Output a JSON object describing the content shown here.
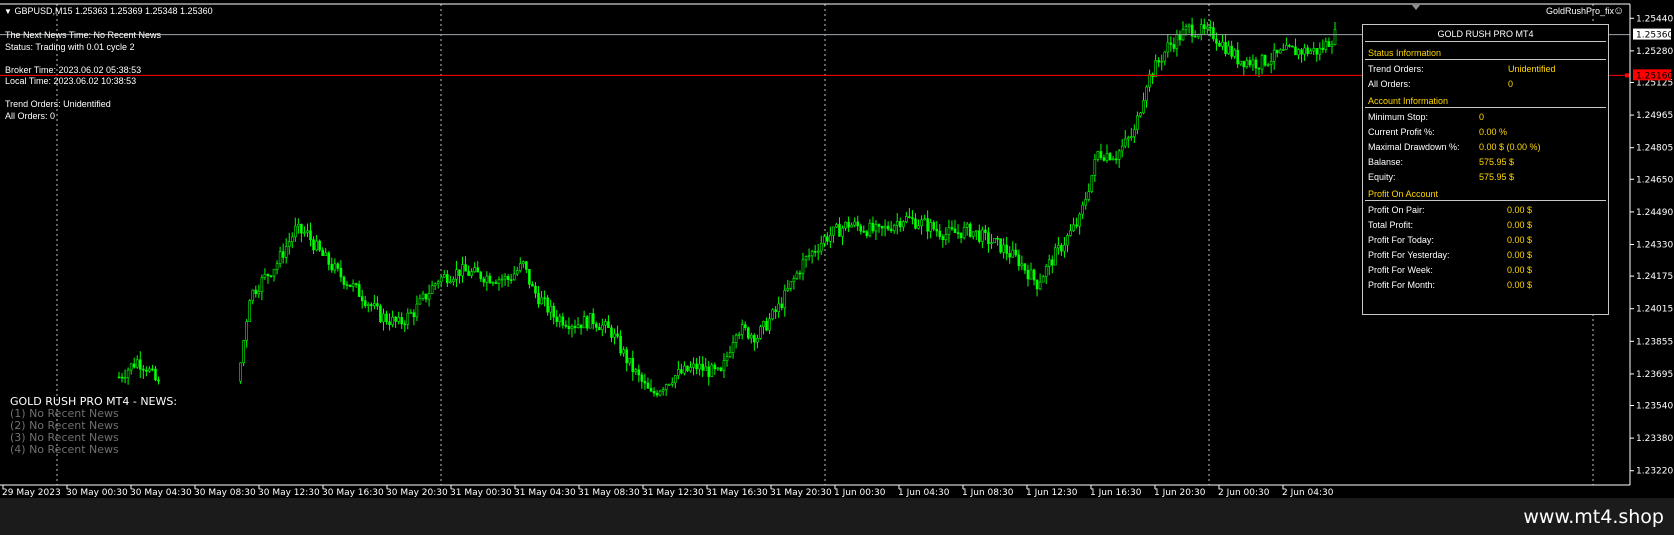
{
  "symbol_header": {
    "label": "GBPUSD,M15  1.25363 1.25369 1.25348 1.25360"
  },
  "ea": {
    "name": "GoldRushPro_fix",
    "face_icon": "smiley-icon"
  },
  "info_lines": {
    "news_time": "The Next News Time: No Recent News",
    "status": "Status: Trading with 0.01 cycle 2",
    "broker_time": "Broker Time: 2023.06.02 05:38:53",
    "local_time": "Local Time: 2023.06.02 10:38:53",
    "trend_orders": "Trend Orders: Unidentified",
    "all_orders": "All Orders: 0"
  },
  "news": {
    "title": "GOLD RUSH PRO MT4 - NEWS:",
    "items": [
      "(1)  No Recent News",
      "(2)  No Recent News",
      "(3)  No Recent News",
      "(4)  No Recent News"
    ]
  },
  "panel": {
    "title": "GOLD RUSH PRO MT4",
    "status_section": "Status Information",
    "status": [
      {
        "k": "Trend Orders:",
        "v": "Unidentified"
      },
      {
        "k": "All Orders:",
        "v": "0"
      }
    ],
    "account_section": "Account Information",
    "account": [
      {
        "k": "Minimum Stop:",
        "v": "0"
      },
      {
        "k": "Current Profit %:",
        "v": "0.00 %"
      },
      {
        "k": "Maximal Drawdown %:",
        "v": "0.00 $ (0.00 %)"
      },
      {
        "k": "Balanse:",
        "v": "575.95 $"
      },
      {
        "k": "Equity:",
        "v": "575.95 $"
      }
    ],
    "profit_section": "Profit On Account",
    "profit": [
      {
        "k": "Profit On Pair:",
        "v": "0.00 $"
      },
      {
        "k": "Total Profit:",
        "v": "0.00 $"
      },
      {
        "k": "Profit For Today:",
        "v": "0.00 $"
      },
      {
        "k": "Profit For Yesterday:",
        "v": "0.00 $"
      },
      {
        "k": "Profit For Week:",
        "v": "0.00 $"
      },
      {
        "k": "Profit For Month:",
        "v": "0.00 $"
      }
    ]
  },
  "price_axis": {
    "ticks": [
      "1.25440",
      "1.25280",
      "1.25125",
      "1.24965",
      "1.24805",
      "1.24650",
      "1.24490",
      "1.24330",
      "1.24175",
      "1.24015",
      "1.23855",
      "1.23695",
      "1.23540",
      "1.23380",
      "1.23220"
    ],
    "tick_values": [
      1.2544,
      1.2528,
      1.25125,
      1.24965,
      1.24805,
      1.2465,
      1.2449,
      1.2433,
      1.24175,
      1.24015,
      1.23855,
      1.23695,
      1.2354,
      1.2338,
      1.2322
    ],
    "bid_label": "1.25360",
    "bid_value": 1.2536,
    "red_label": "1.25160",
    "red_value": 1.2516
  },
  "time_axis": {
    "labels": [
      "29 May 2023",
      "30 May 00:30",
      "30 May 04:30",
      "30 May 08:30",
      "30 May 12:30",
      "30 May 16:30",
      "30 May 20:30",
      "31 May 00:30",
      "31 May 04:30",
      "31 May 08:30",
      "31 May 12:30",
      "31 May 16:30",
      "31 May 20:30",
      "1 Jun 00:30",
      "1 Jun 04:30",
      "1 Jun 08:30",
      "1 Jun 12:30",
      "1 Jun 16:30",
      "1 Jun 20:30",
      "2 Jun 00:30",
      "2 Jun 04:30"
    ]
  },
  "chart_data": {
    "type": "candlestick",
    "symbol": "GBPUSD",
    "timeframe": "M15",
    "ylim": [
      1.2315,
      1.2551
    ],
    "colors": {
      "bull": "#00ff00",
      "bear": "#00ff00",
      "grid": "#c0c0c0",
      "bid_line": "#9fa8b0",
      "red_line": "#ff0000"
    },
    "close_path": [
      [
        0,
        1.2368
      ],
      [
        6,
        1.2376
      ],
      [
        9,
        1.2373
      ],
      [
        13,
        1.2364
      ],
      [
        20,
        1.2356
      ],
      [
        32,
        1.2358
      ],
      [
        40,
        1.2375
      ],
      [
        43,
        1.2408
      ],
      [
        52,
        1.2424
      ],
      [
        58,
        1.244
      ],
      [
        62,
        1.2438
      ],
      [
        66,
        1.2429
      ],
      [
        72,
        1.2419
      ],
      [
        80,
        1.2408
      ],
      [
        86,
        1.2398
      ],
      [
        92,
        1.2394
      ],
      [
        97,
        1.24
      ],
      [
        105,
        1.2416
      ],
      [
        112,
        1.242
      ],
      [
        122,
        1.2417
      ],
      [
        128,
        1.2416
      ],
      [
        133,
        1.2423
      ],
      [
        136,
        1.2411
      ],
      [
        143,
        1.2398
      ],
      [
        150,
        1.2394
      ],
      [
        156,
        1.2396
      ],
      [
        162,
        1.239
      ],
      [
        168,
        1.2374
      ],
      [
        175,
        1.2359
      ],
      [
        182,
        1.2368
      ],
      [
        190,
        1.2373
      ],
      [
        198,
        1.2369
      ],
      [
        203,
        1.2392
      ],
      [
        210,
        1.2388
      ],
      [
        217,
        1.2402
      ],
      [
        225,
        1.2424
      ],
      [
        232,
        1.2436
      ],
      [
        240,
        1.2443
      ],
      [
        250,
        1.2439
      ],
      [
        258,
        1.2446
      ],
      [
        265,
        1.2443
      ],
      [
        272,
        1.2438
      ],
      [
        280,
        1.244
      ],
      [
        290,
        1.2432
      ],
      [
        296,
        1.2425
      ],
      [
        302,
        1.2414
      ],
      [
        308,
        1.2428
      ],
      [
        316,
        1.2445
      ],
      [
        322,
        1.2478
      ],
      [
        328,
        1.2477
      ],
      [
        334,
        1.2488
      ],
      [
        338,
        1.2513
      ],
      [
        345,
        1.253
      ],
      [
        352,
        1.2539
      ],
      [
        360,
        1.2536
      ],
      [
        368,
        1.2524
      ],
      [
        375,
        1.2522
      ],
      [
        385,
        1.2528
      ],
      [
        395,
        1.2528
      ],
      [
        400,
        1.2536
      ]
    ]
  }
}
